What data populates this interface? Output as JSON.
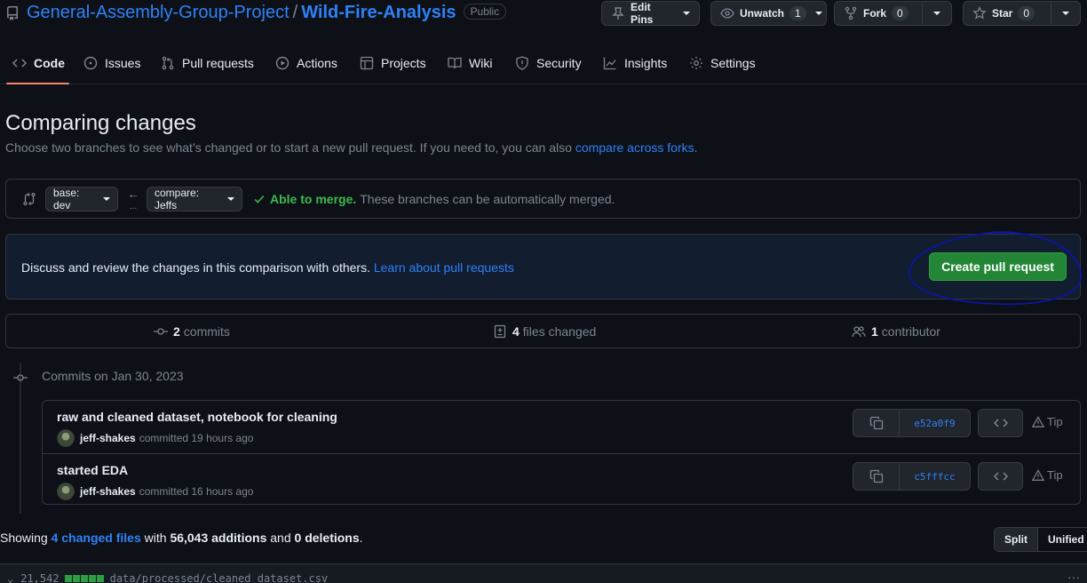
{
  "repo": {
    "owner": "General-Assembly-Group-Project",
    "separator": "/",
    "name": "Wild-Fire-Analysis",
    "visibility": "Public"
  },
  "header_actions": {
    "edit_pins": "Edit Pins",
    "unwatch": "Unwatch",
    "watch_count": "1",
    "fork": "Fork",
    "fork_count": "0",
    "star": "Star",
    "star_count": "0"
  },
  "tabs": [
    {
      "label": "Code",
      "icon": "code-icon",
      "active": true
    },
    {
      "label": "Issues",
      "icon": "issue-icon"
    },
    {
      "label": "Pull requests",
      "icon": "pull-request-icon"
    },
    {
      "label": "Actions",
      "icon": "play-icon"
    },
    {
      "label": "Projects",
      "icon": "table-icon"
    },
    {
      "label": "Wiki",
      "icon": "book-icon"
    },
    {
      "label": "Security",
      "icon": "shield-icon"
    },
    {
      "label": "Insights",
      "icon": "graph-icon"
    },
    {
      "label": "Settings",
      "icon": "gear-icon"
    }
  ],
  "page": {
    "title": "Comparing changes",
    "subtitle": "Choose two branches to see what’s changed or to start a new pull request. If you need to, you can also",
    "subtitle_link": "compare across forks",
    "subtitle_end": "."
  },
  "range": {
    "base": "base: dev",
    "arrow": "←",
    "dots": "...",
    "compare": "compare: Jeffs",
    "merge_ok": "Able to merge.",
    "merge_text": "These branches can be automatically merged."
  },
  "discuss": {
    "text": "Discuss and review the changes in this comparison with others.",
    "link": "Learn about pull requests",
    "button": "Create pull request"
  },
  "annotation": {
    "color": "#0a14b4"
  },
  "summary": {
    "commits_count": "2",
    "commits_label": "commits",
    "files_count": "4",
    "files_label": "files changed",
    "contrib_count": "1",
    "contrib_label": "contributor"
  },
  "commits_date": "Commits on Jan 30, 2023",
  "commits": [
    {
      "message": "raw and cleaned dataset, notebook for cleaning",
      "author": "jeff-shakes",
      "when": "committed 19 hours ago",
      "sha": "e52a0f9",
      "tip": "Tip"
    },
    {
      "message": "started EDA",
      "author": "jeff-shakes",
      "when": "committed 16 hours ago",
      "sha": "c5fffcc",
      "tip": "Tip"
    }
  ],
  "toc": {
    "showing": "Showing",
    "changed_files": "4 changed files",
    "with": "with",
    "additions": "56,043 additions",
    "and": "and",
    "deletions": "0 deletions",
    "period": "."
  },
  "view_toggle": {
    "split": "Split",
    "unified": "Unified"
  },
  "file": {
    "expand": "⌄",
    "lines": "21,542",
    "path": "data/processed/cleaned_dataset.csv",
    "more": "···"
  },
  "colors": {
    "accent": "#2f81f7",
    "success": "#238636",
    "tab_underline": "#f78166",
    "background": "#0d1117"
  }
}
